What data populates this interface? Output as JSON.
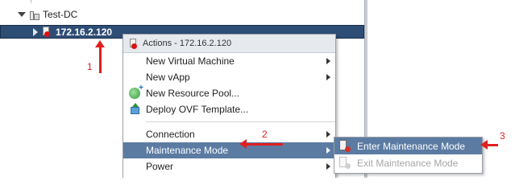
{
  "tree": {
    "datacenter_label": "Test-DC",
    "host_label": "172.16.2.120"
  },
  "annotations": {
    "step1": "1",
    "step2": "2",
    "step3": "3"
  },
  "context_menu": {
    "header": "Actions - 172.16.2.120",
    "items": [
      {
        "label": "New Virtual Machine"
      },
      {
        "label": "New vApp"
      },
      {
        "label": "New Resource Pool..."
      },
      {
        "label": "Deploy OVF Template..."
      },
      {
        "label": "Connection"
      },
      {
        "label": "Maintenance Mode"
      },
      {
        "label": "Power"
      }
    ]
  },
  "submenu": {
    "items": [
      {
        "label": "Enter Maintenance Mode"
      },
      {
        "label": "Exit Maintenance Mode"
      }
    ]
  },
  "colors": {
    "selected_tree_row": "#2e4d75",
    "selected_menu_item": "#5b7ba3",
    "annotation": "#e02020"
  }
}
